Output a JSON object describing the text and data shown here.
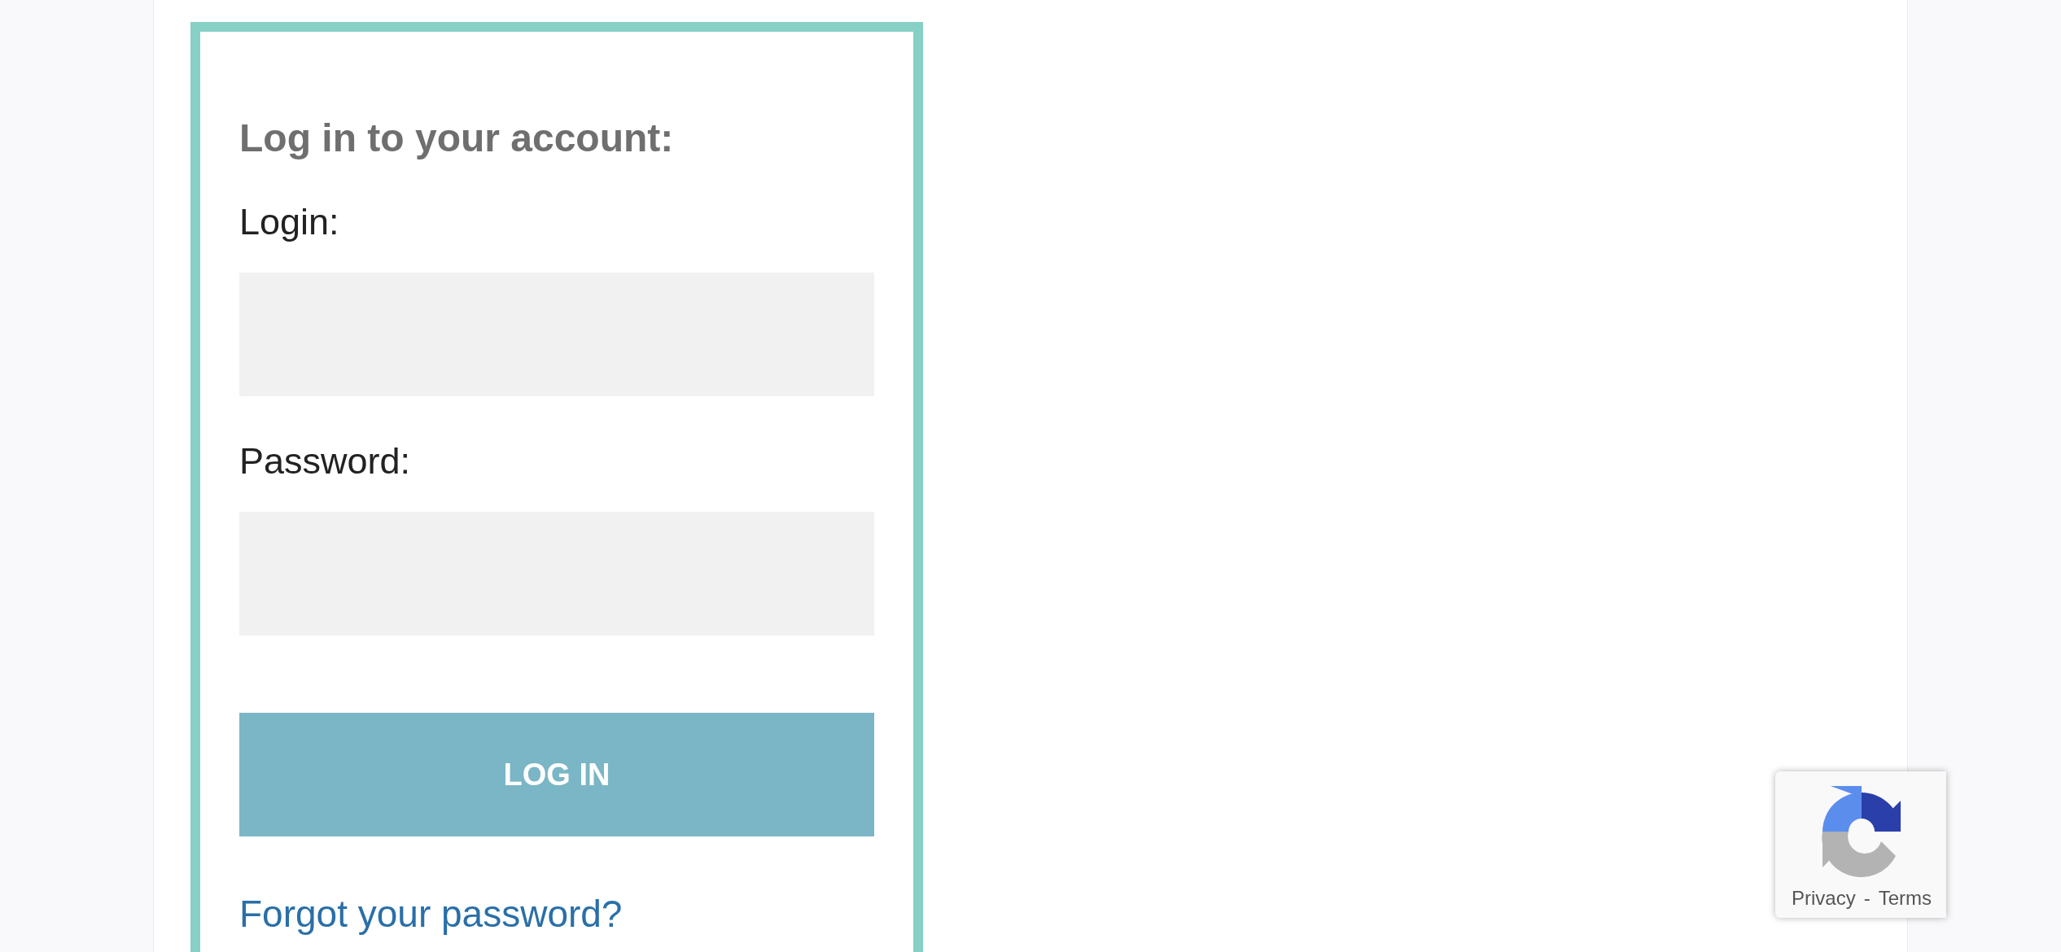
{
  "form": {
    "title": "Log in to your account:",
    "fields": [
      {
        "label": "Login:"
      },
      {
        "label": "Password:"
      }
    ],
    "submit": "LOG IN",
    "forgot_link": "Forgot your password?"
  },
  "recaptcha": {
    "privacy": "Privacy",
    "separator": "-",
    "terms": "Terms"
  }
}
